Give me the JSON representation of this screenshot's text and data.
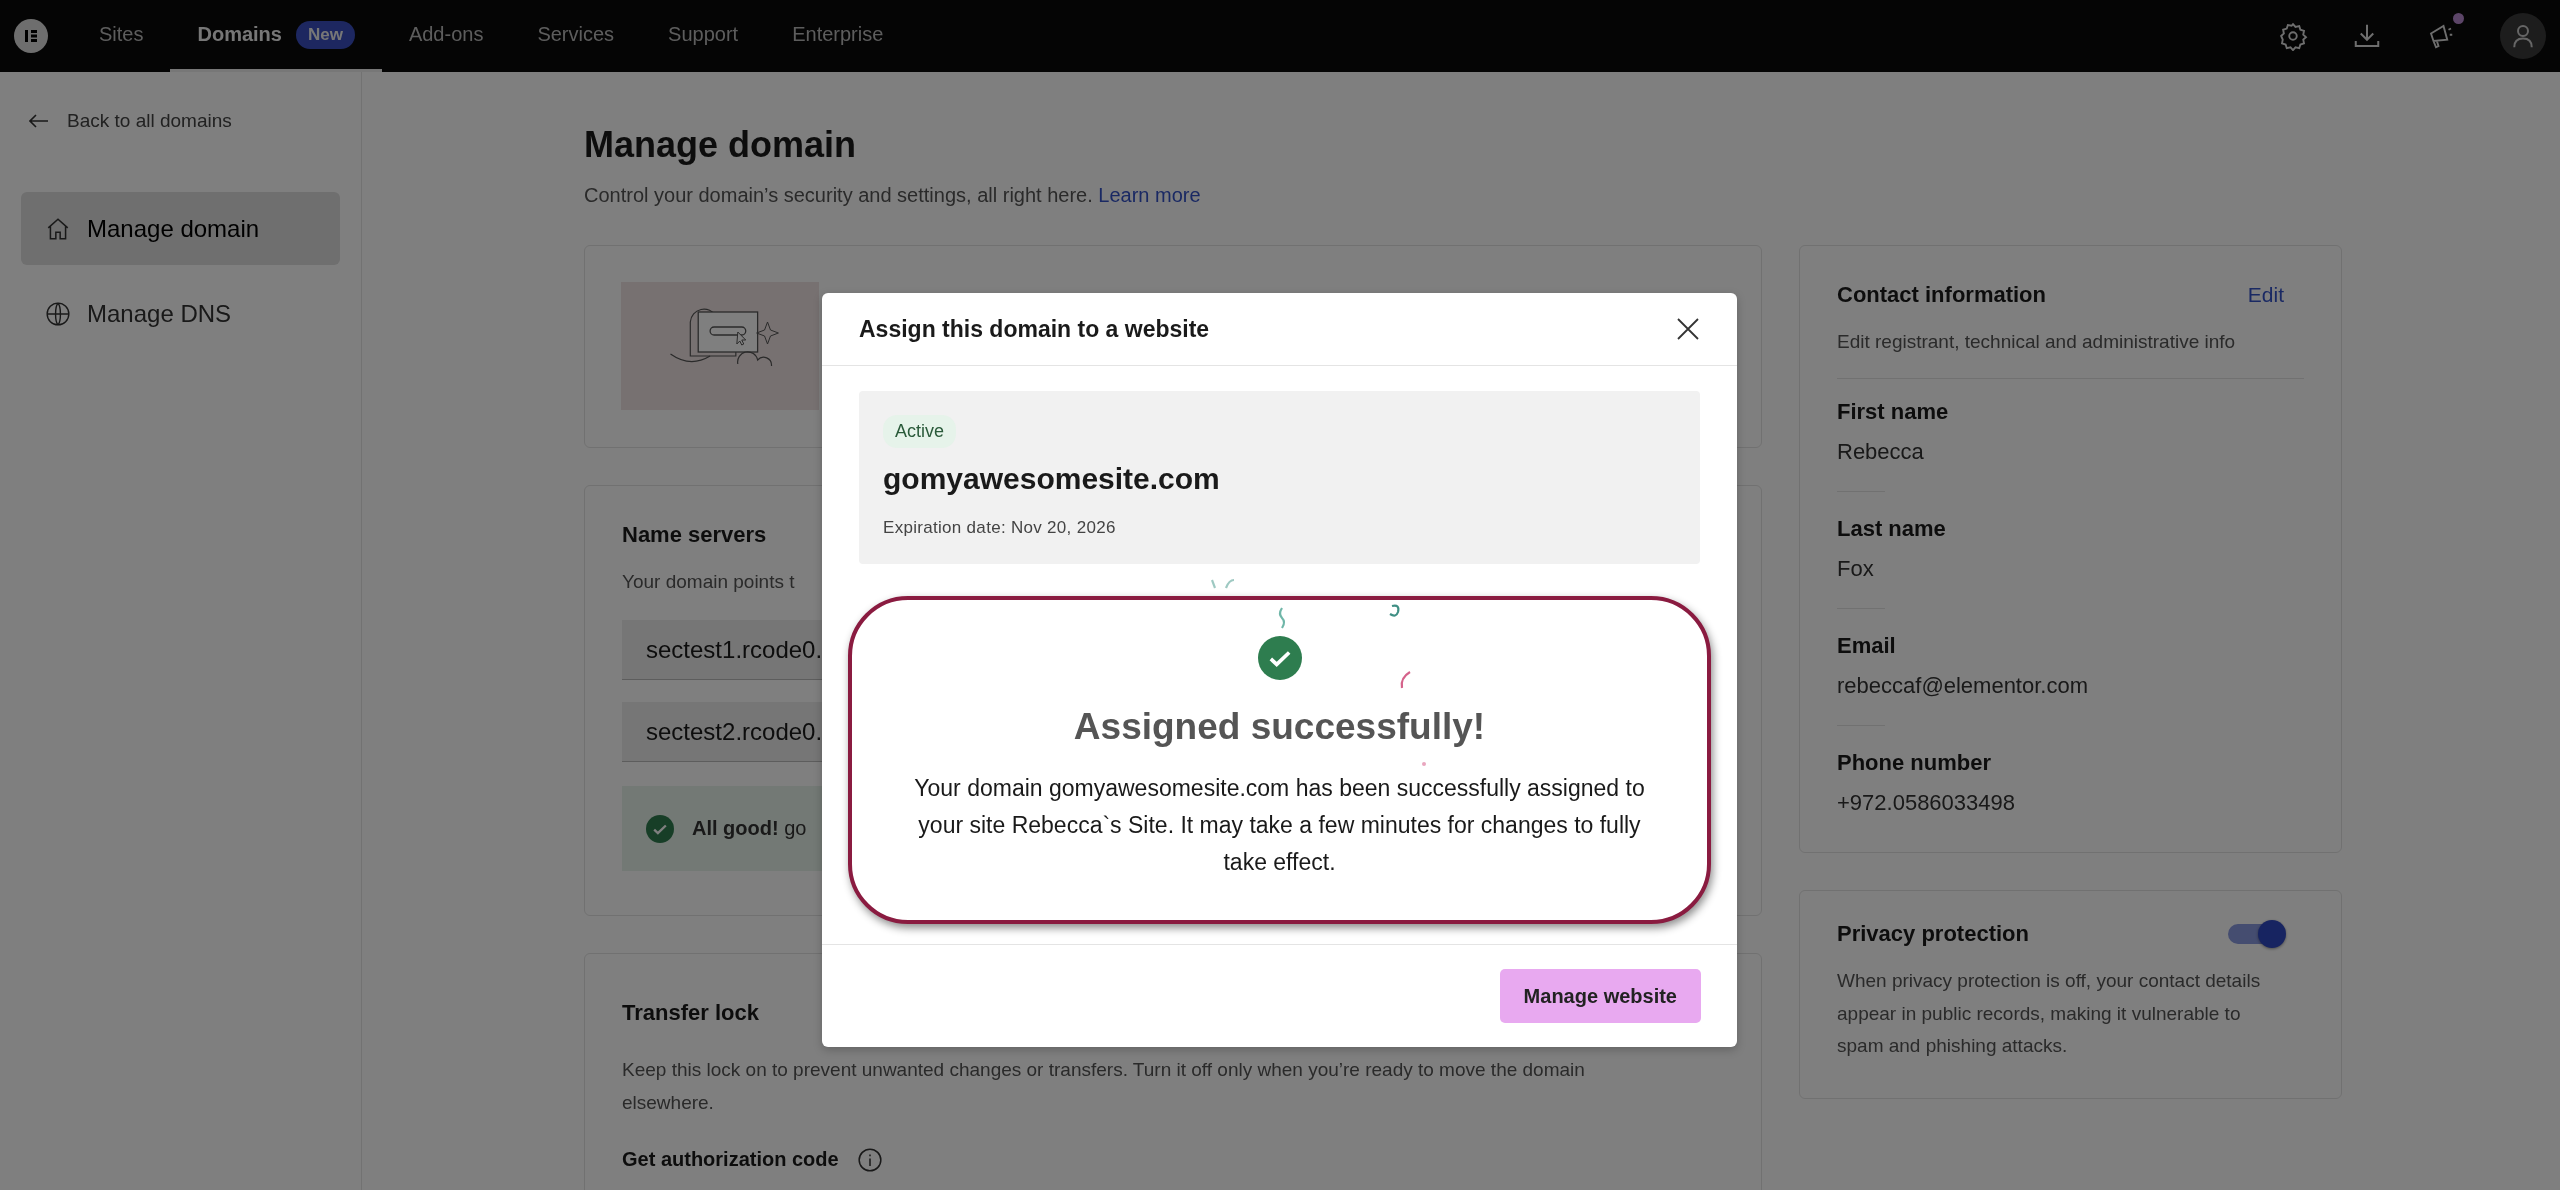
{
  "topbar": {
    "nav": [
      {
        "label": "Sites",
        "selected": false
      },
      {
        "label": "Domains",
        "selected": true,
        "badge": "New"
      },
      {
        "label": "Add-ons",
        "selected": false
      },
      {
        "label": "Services",
        "selected": false
      },
      {
        "label": "Support",
        "selected": false
      },
      {
        "label": "Enterprise",
        "selected": false
      }
    ],
    "notifications_unread": true
  },
  "sidebar": {
    "back_link": "Back to all domains",
    "items": [
      {
        "label": "Manage domain",
        "kind": "home",
        "selected": true
      },
      {
        "label": "Manage DNS",
        "kind": "dns",
        "selected": false
      }
    ]
  },
  "page": {
    "title": "Manage domain",
    "subtitle": "Control your domain’s security and settings, all right here.",
    "learn_more": "Learn more"
  },
  "name_servers": {
    "title": "Name servers",
    "description": "Your domain points t",
    "servers": [
      "sectest1.rcode0.",
      "sectest2.rcode0."
    ],
    "alert": "**All good!** go"
  },
  "transfer_lock": {
    "title": "Transfer lock",
    "description": "Keep this lock on to prevent unwanted changes or transfers. Turn it off only when you’re ready to move the domain elsewhere.",
    "auth_code": "Get authorization code"
  },
  "contact": {
    "title": "Contact information",
    "edit": "Edit",
    "description": "Edit registrant, technical and administrative info",
    "fields": [
      {
        "label": "First name",
        "value": "Rebecca"
      },
      {
        "label": "Last name",
        "value": "Fox"
      },
      {
        "label": "Email",
        "value": "rebeccaf@elementor.com"
      },
      {
        "label": "Phone number",
        "value": "+972.0586033498"
      }
    ]
  },
  "privacy": {
    "title": "Privacy protection",
    "on": true,
    "description": "When privacy protection is off, your contact details appear in public records, making it vulnerable to spam and phishing attacks."
  },
  "modal": {
    "title": "Assign this domain to a website",
    "domain": {
      "status": "Active",
      "name": "gomyawesomesite.com",
      "expiration": "Expiration date: Nov 20, 2026"
    },
    "success": {
      "title": "Assigned successfully!",
      "message": "Your domain gomyawesomesite.com has been successfully assigned to your site Rebecca`s Site. It may take a few minutes for changes to fully take effect."
    },
    "button": "Manage website"
  }
}
